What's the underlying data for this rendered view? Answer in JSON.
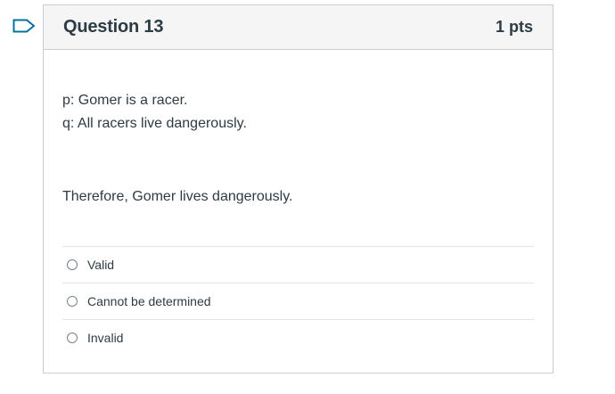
{
  "question": {
    "title": "Question 13",
    "points": "1 pts",
    "premise_p": "p: Gomer is a racer.",
    "premise_q": "q: All racers live dangerously.",
    "conclusion": "Therefore, Gomer lives dangerously."
  },
  "answers": [
    {
      "label": "Valid"
    },
    {
      "label": "Cannot be determined"
    },
    {
      "label": "Invalid"
    }
  ],
  "colors": {
    "flag": "#0770a3",
    "header_bg": "#f5f5f5",
    "border": "#c7cdd1",
    "text": "#2d3b45"
  },
  "icons": {
    "flag": "flag-question-icon"
  }
}
